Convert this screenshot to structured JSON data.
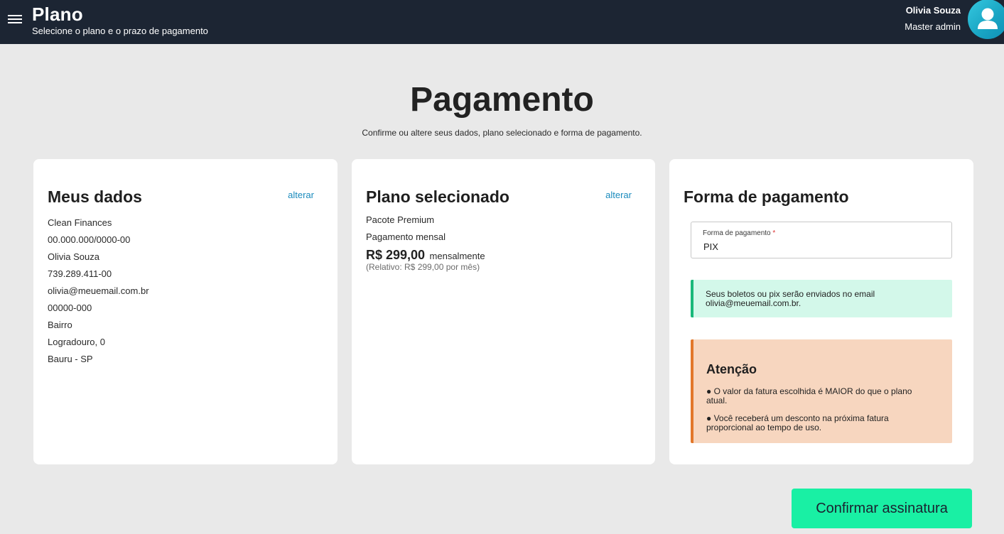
{
  "header": {
    "title": "Plano",
    "subtitle": "Selecione o plano e o prazo de pagamento",
    "user_name": "Olivia Souza",
    "user_role": "Master admin",
    "menu_icon": "hamburger-menu-icon",
    "avatar_icon": "user-icon"
  },
  "page": {
    "title": "Pagamento",
    "subtitle": "Confirme ou altere seus dados, plano selecionado e forma de pagamento."
  },
  "my_data": {
    "title": "Meus dados",
    "edit_label": "alterar",
    "lines": [
      "Clean Finances",
      "00.000.000/0000-00",
      "Olivia Souza",
      "739.289.411-00",
      "olivia@meuemail.com.br",
      "00000-000",
      "Bairro",
      "Logradouro, 0",
      "Bauru - SP"
    ]
  },
  "plan": {
    "title": "Plano selecionado",
    "edit_label": "alterar",
    "name": "Pacote Premium",
    "period": "Pagamento mensal",
    "price": "R$ 299,00",
    "price_suffix": "mensalmente",
    "relative": "(Relativo: R$ 299,00 por mês)"
  },
  "payment": {
    "title": "Forma de pagamento",
    "field_label": "Forma de pagamento",
    "required_mark": "*",
    "field_value": "PIX",
    "info_text": "Seus boletos ou pix serão enviados no email olivia@meuemail.com.br.",
    "warning_title": "Atenção",
    "warning_items": [
      "● O valor da fatura escolhida é MAIOR do que o plano atual.",
      "● Você receberá um desconto na próxima fatura proporcional ao tempo de uso."
    ]
  },
  "actions": {
    "confirm_label": "Confirmar assinatura"
  },
  "colors": {
    "topbar": "#1c2533",
    "accent_button": "#19f0a4",
    "link": "#1a8bbd",
    "info_bg": "#d3f8ea",
    "info_border": "#19b87a",
    "warning_bg": "#f7d6bf",
    "warning_border": "#e2772a"
  }
}
